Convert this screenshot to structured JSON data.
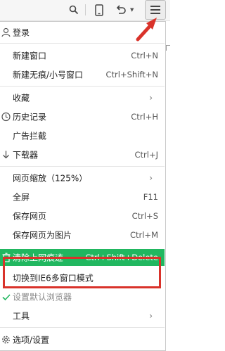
{
  "menu": {
    "items": [
      {
        "label": "登录",
        "shortcut": "",
        "icon": "user-icon"
      },
      {
        "label": "新建窗口",
        "shortcut": "Ctrl+N"
      },
      {
        "label": "新建无痕/小号窗口",
        "shortcut": "Ctrl+Shift+N"
      },
      {
        "label": "收藏",
        "shortcut": ""
      },
      {
        "label": "历史记录",
        "shortcut": "Ctrl+H",
        "icon": "clock-icon"
      },
      {
        "label": "广告拦截",
        "shortcut": ""
      },
      {
        "label": "下载器",
        "shortcut": "Ctrl+J",
        "icon": "download-icon"
      },
      {
        "label": "网页缩放（125%）",
        "shortcut": ""
      },
      {
        "label": "全屏",
        "shortcut": "F11"
      },
      {
        "label": "保存网页",
        "shortcut": "Ctrl+S"
      },
      {
        "label": "保存网页为图片",
        "shortcut": "Ctrl+M"
      },
      {
        "label": "清除上网痕迹",
        "shortcut": "Ctrl+Shift+Delete",
        "icon": "trash-icon"
      },
      {
        "label": "切换到IE6多窗口模式",
        "shortcut": ""
      },
      {
        "label": "设置默认浏览器",
        "shortcut": "",
        "icon": "checkmark-icon"
      },
      {
        "label": "工具",
        "shortcut": ""
      },
      {
        "label": "选项/设置",
        "shortcut": "",
        "icon": "gear-icon"
      }
    ]
  },
  "colors": {
    "highlight": "#21b760",
    "annotation": "#d9322a"
  }
}
